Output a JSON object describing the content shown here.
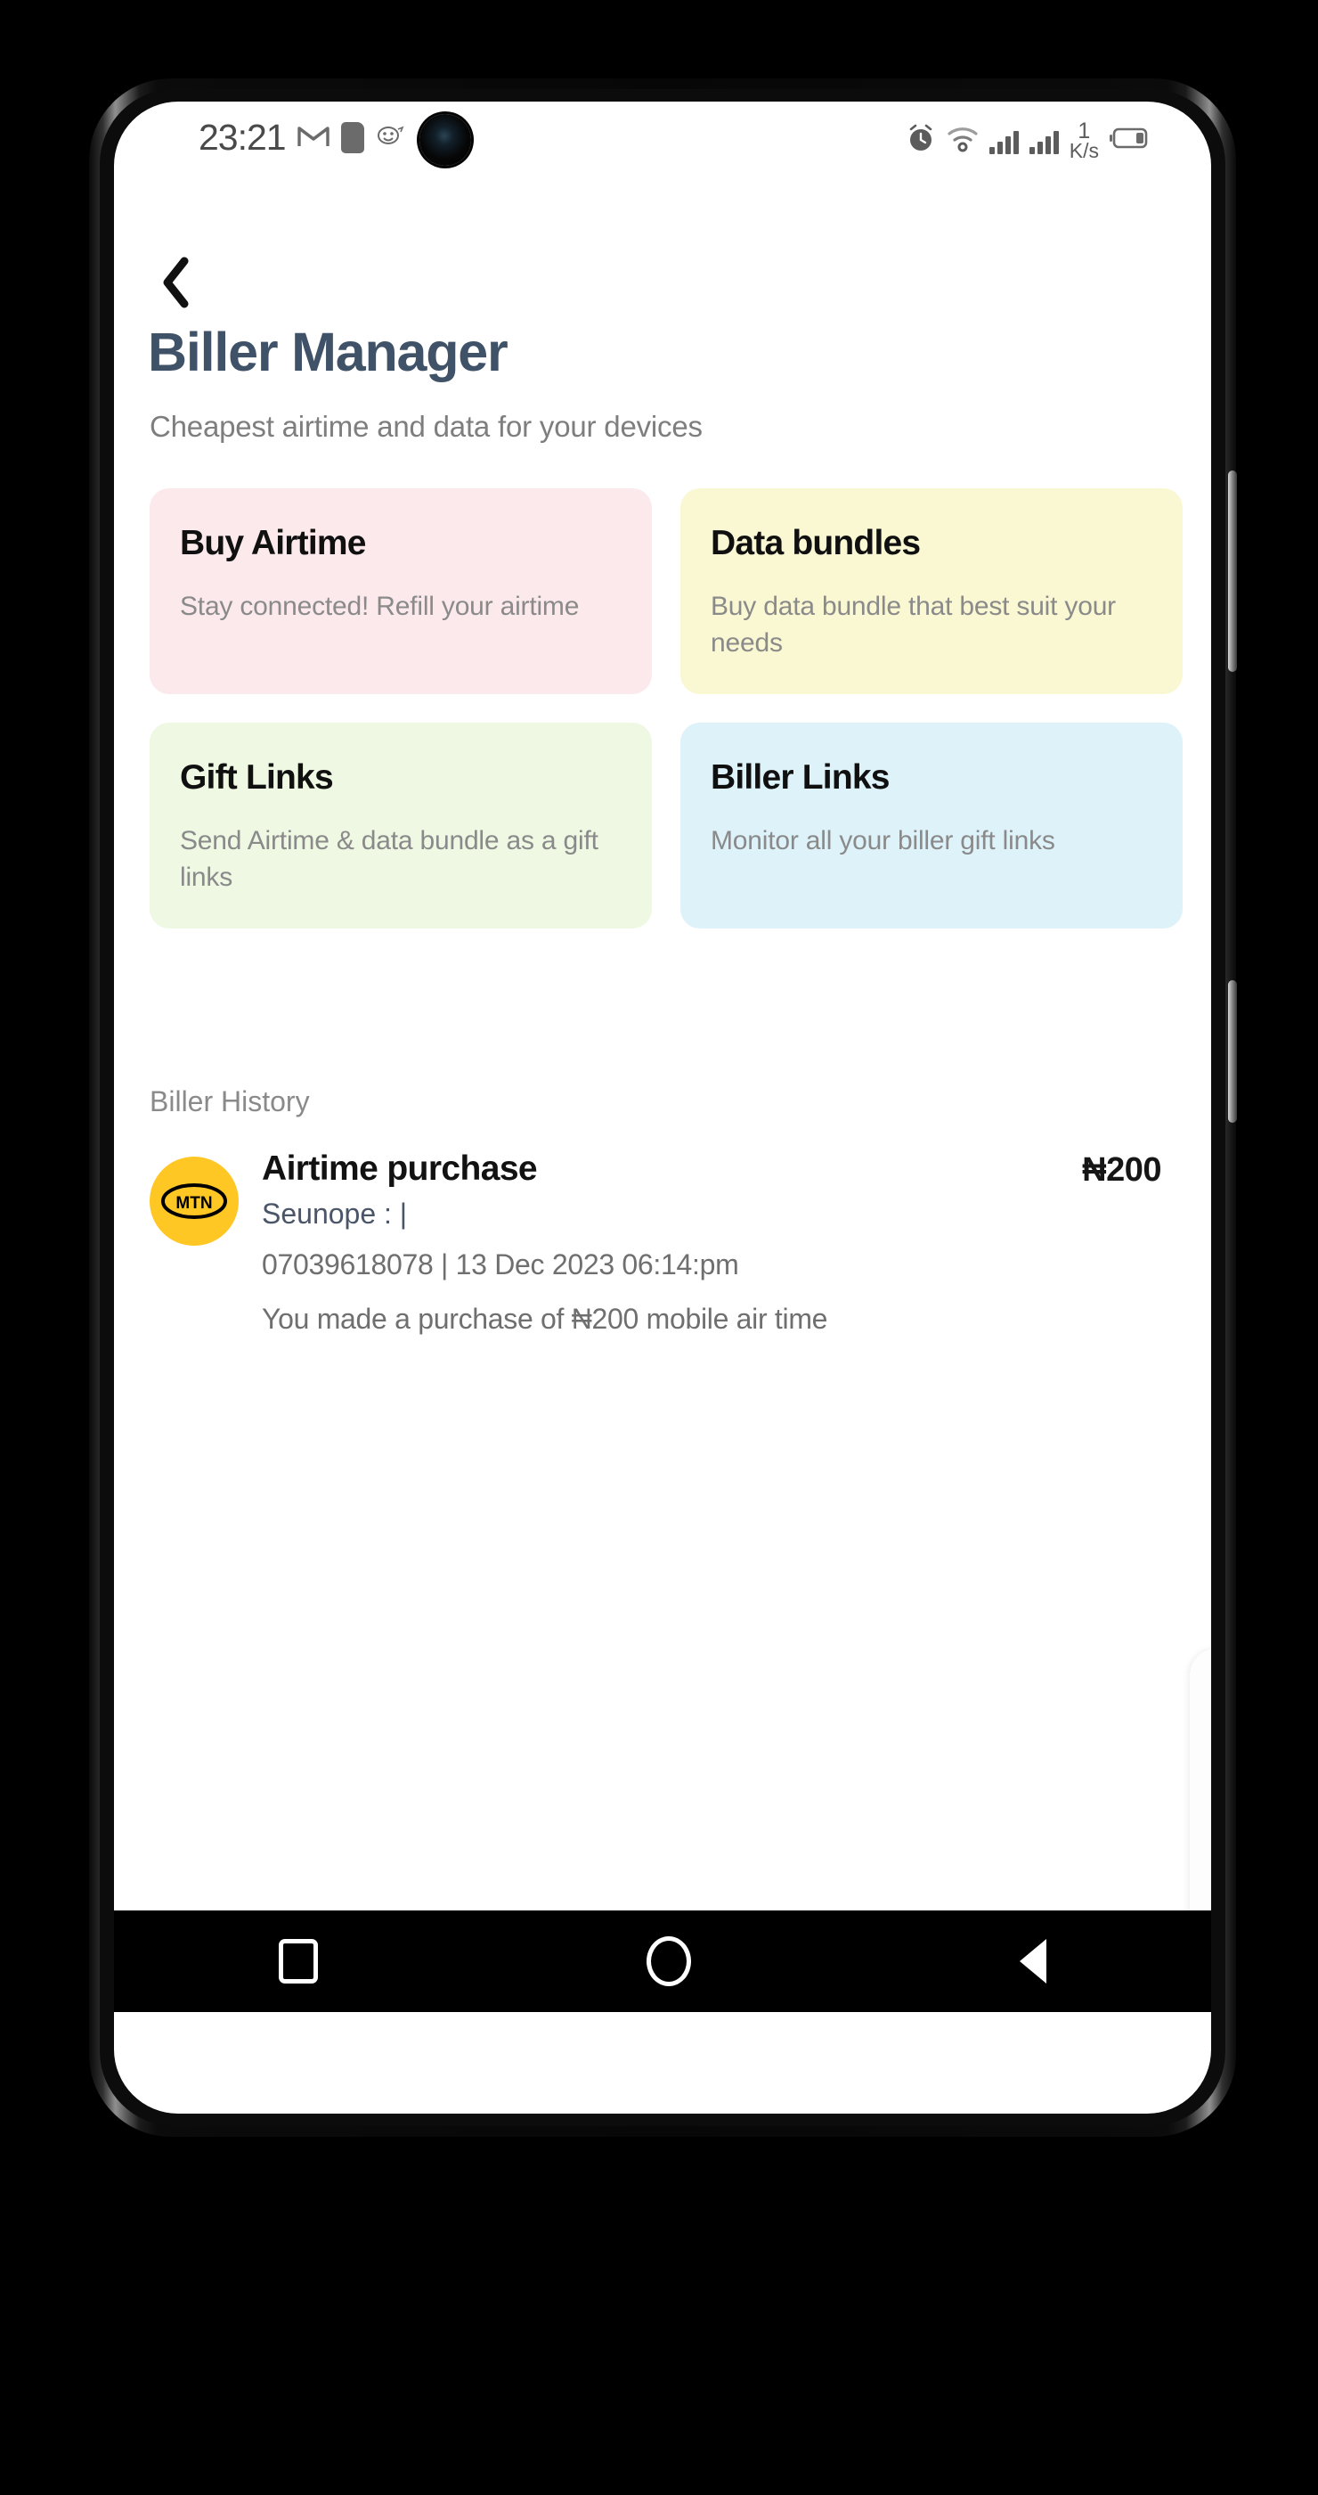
{
  "status_bar": {
    "time": "23:21",
    "icons_left": [
      "gmail-icon",
      "note-icon",
      "app-icon",
      "dot-icon"
    ],
    "network_speed_value": "1",
    "network_speed_unit": "K/s",
    "icons_right": [
      "alarm-icon",
      "wifi-icon",
      "signal-bars-sim1",
      "signal-bars-sim2",
      "battery-icon"
    ]
  },
  "header": {
    "back_icon": "chevron-left-icon",
    "title": "Biller Manager",
    "subtitle": "Cheapest airtime and data for your devices",
    "title_color": "#3f5268"
  },
  "cards": [
    {
      "title": "Buy Airtime",
      "description": "Stay connected! Refill your airtime",
      "bg": "#fce9ec"
    },
    {
      "title": "Data bundles",
      "description": "Buy data bundle that best suit your needs",
      "bg": "#faf8d3"
    },
    {
      "title": "Gift Links",
      "description": "Send Airtime & data bundle as a gift links",
      "bg": "#eef8e2"
    },
    {
      "title": "Biller Links",
      "description": "Monitor all your biller gift links",
      "bg": "#ddf2f9"
    }
  ],
  "history": {
    "section_title": "Biller History",
    "items": [
      {
        "provider_logo_text": "MTN",
        "provider_logo_color": "#FFC723",
        "name": "Airtime purchase",
        "account": "Seunope : |",
        "meta": "07039618078 | 13 Dec 2023 06:14:pm",
        "description": "You made a purchase of ₦200 mobile air time",
        "amount": "₦200"
      }
    ]
  },
  "navbar": {
    "recents_label": "Recents",
    "home_label": "Home",
    "back_label": "Back"
  }
}
